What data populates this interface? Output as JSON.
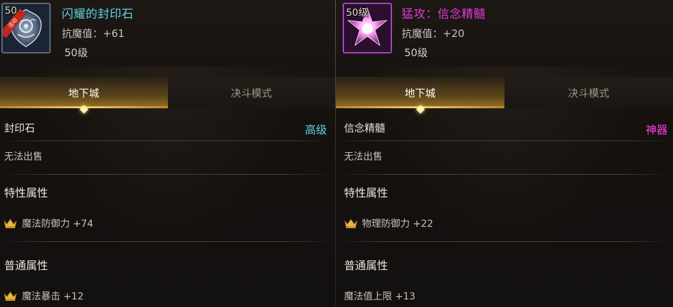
{
  "left": {
    "icon": {
      "name": "seal-stone-icon",
      "level_badge": "50",
      "ribbon_text": "活动"
    },
    "item_name": "闪耀的封印石",
    "stat": "抗魔值：+61",
    "level": "50级",
    "tabs": [
      "地下城",
      "决斗模式"
    ],
    "category": "封印石",
    "grade": "高级",
    "no_sell": "无法出售",
    "special_title": "特性属性",
    "special_attr": "魔法防御力 +74",
    "normal_title": "普通属性",
    "normal_attr": "魔法暴击 +12",
    "colors": {
      "name": "#5fd2e6",
      "grade": "#5fd2e6"
    }
  },
  "right": {
    "icon": {
      "name": "pink-star-essence-icon",
      "level_badge": "50级"
    },
    "item_name": "猛攻：信念精髓",
    "stat": "抗魔值：+20",
    "level": "50级",
    "tabs": [
      "地下城",
      "决斗模式"
    ],
    "category": "信念精髓",
    "grade": "神器",
    "no_sell": "无法出售",
    "special_title": "特性属性",
    "special_attr": "物理防御力 +22",
    "normal_title": "普通属性",
    "normal_attr": "魔法值上限 +13",
    "colors": {
      "name": "#e43ad8",
      "grade": "#ff3ee0"
    }
  },
  "accent_gold": "#f2cc66",
  "crown_icon": "crown-icon"
}
